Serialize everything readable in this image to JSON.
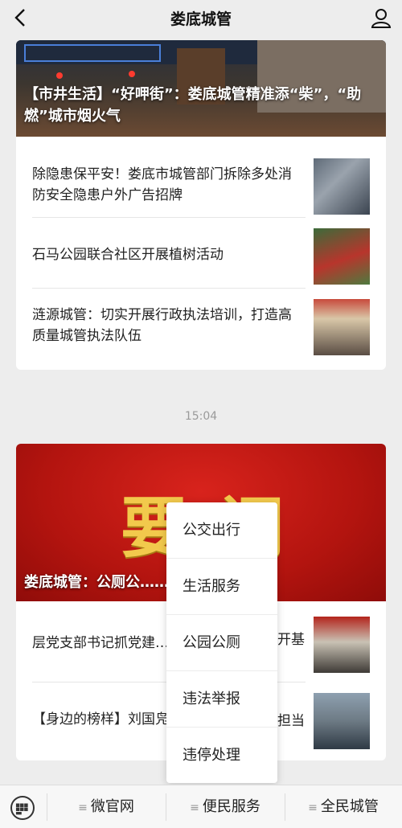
{
  "header": {
    "title": "娄底城管"
  },
  "card1": {
    "hero_title": "【市井生活】“好呷街”：娄底城管精准添“柴”，“助燃”城市烟火气",
    "items": [
      {
        "text": "除隐患保平安！娄底市城管部门拆除多处消防安全隐患户外广告招牌"
      },
      {
        "text": "石马公园联合社区开展植树活动"
      },
      {
        "text": "涟源城管：切实开展行政执法培训，打造高质量城管执法队伍"
      }
    ]
  },
  "time": "15:04",
  "card2": {
    "hero_banner": "要闻",
    "hero_title": "娄底城管：公厕公……打开方便之门",
    "items": [
      {
        "text": "层党支部书记抓党建……",
        "tail": "开基"
      },
      {
        "text": "【身边的榜样】刘国凫……",
        "tail": "担当"
      }
    ]
  },
  "popup": {
    "items": [
      "公交出行",
      "生活服务",
      "公园公厕",
      "违法举报",
      "违停处理"
    ]
  },
  "bottom_menu": {
    "items": [
      "微官网",
      "便民服务",
      "全民城管"
    ]
  }
}
